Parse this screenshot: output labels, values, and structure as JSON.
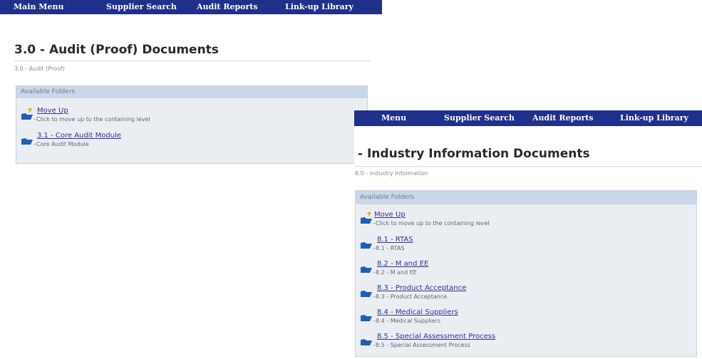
{
  "screens": [
    {
      "nav": [
        "Main Menu",
        "Supplier Search",
        "Audit Reports",
        "Link-up Library"
      ],
      "title": "3.0 - Audit (Proof) Documents",
      "breadcrumb": "3.0 - Audit (Proof)",
      "folders_header": "Available Folders",
      "folders": [
        {
          "label": "Move Up",
          "description": "Click to move up to the containing level"
        },
        {
          "label": "3.1 - Core Audit Module",
          "description": "Core Audit Module"
        }
      ]
    },
    {
      "nav": [
        "Menu",
        "Supplier Search",
        "Audit Reports",
        "Link-up Library"
      ],
      "title": "- Industry Information Documents",
      "breadcrumb": "8.0 - Industry Information",
      "folders_header": "Available Folders",
      "folders": [
        {
          "label": "Move Up",
          "description": "Click to move up to the containing level"
        },
        {
          "label": "8.1 - RTAS",
          "description": "8.1 - RTAS"
        },
        {
          "label": "8.2 - M and EE",
          "description": "8.2 - M and EE"
        },
        {
          "label": "8.3 - Product Acceptance",
          "description": "8.3 - Product Acceptance"
        },
        {
          "label": "8.4 - Medical Suppliers",
          "description": "8.4 - Medical Suppliers"
        },
        {
          "label": "8.5 - Special Assessment Process",
          "description": "8.5 - Special Assessment Process"
        }
      ]
    }
  ],
  "colors": {
    "nav_bg": "#1f2f8a",
    "folder_header_bg": "#c9d8e8",
    "folder_icon": "#1f5fb8",
    "link": "#3a2e8c"
  },
  "icons": {
    "folder": "folder-icon",
    "move_up": "move-up-folder-icon"
  }
}
